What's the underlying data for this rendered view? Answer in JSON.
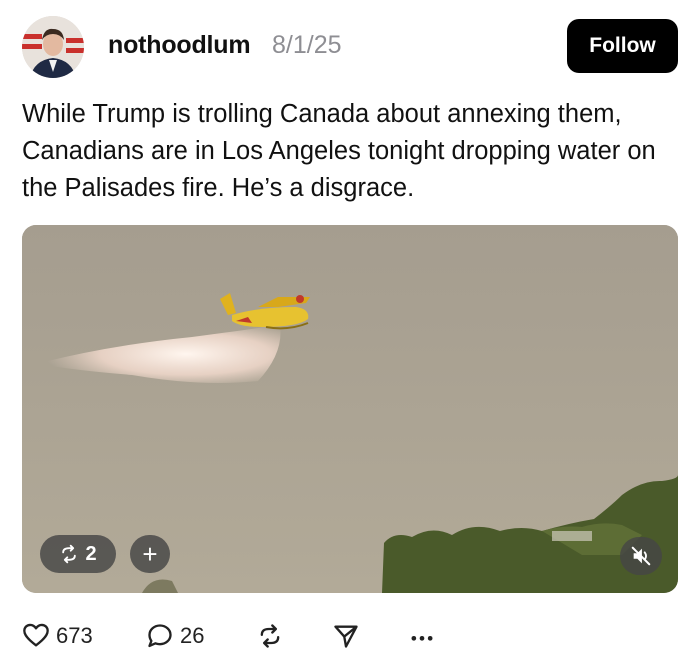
{
  "post": {
    "username": "nothoodlum",
    "timestamp": "8/1/25",
    "follow_label": "Follow",
    "text": "While Trump is trolling Canada about annexing them, Canadians are in Los Angeles tonight dropping water on the Palisades fire. He’s a disgrace."
  },
  "media": {
    "repost_count": "2",
    "add_label": "+"
  },
  "actions": {
    "likes": "673",
    "comments": "26"
  },
  "icons": {
    "avatar": "avatar-image",
    "repost": "repost-icon",
    "mute": "speaker-muted-icon",
    "like": "heart-icon",
    "comment": "comment-bubble-icon",
    "share": "send-icon",
    "more": "more-dots-icon"
  }
}
